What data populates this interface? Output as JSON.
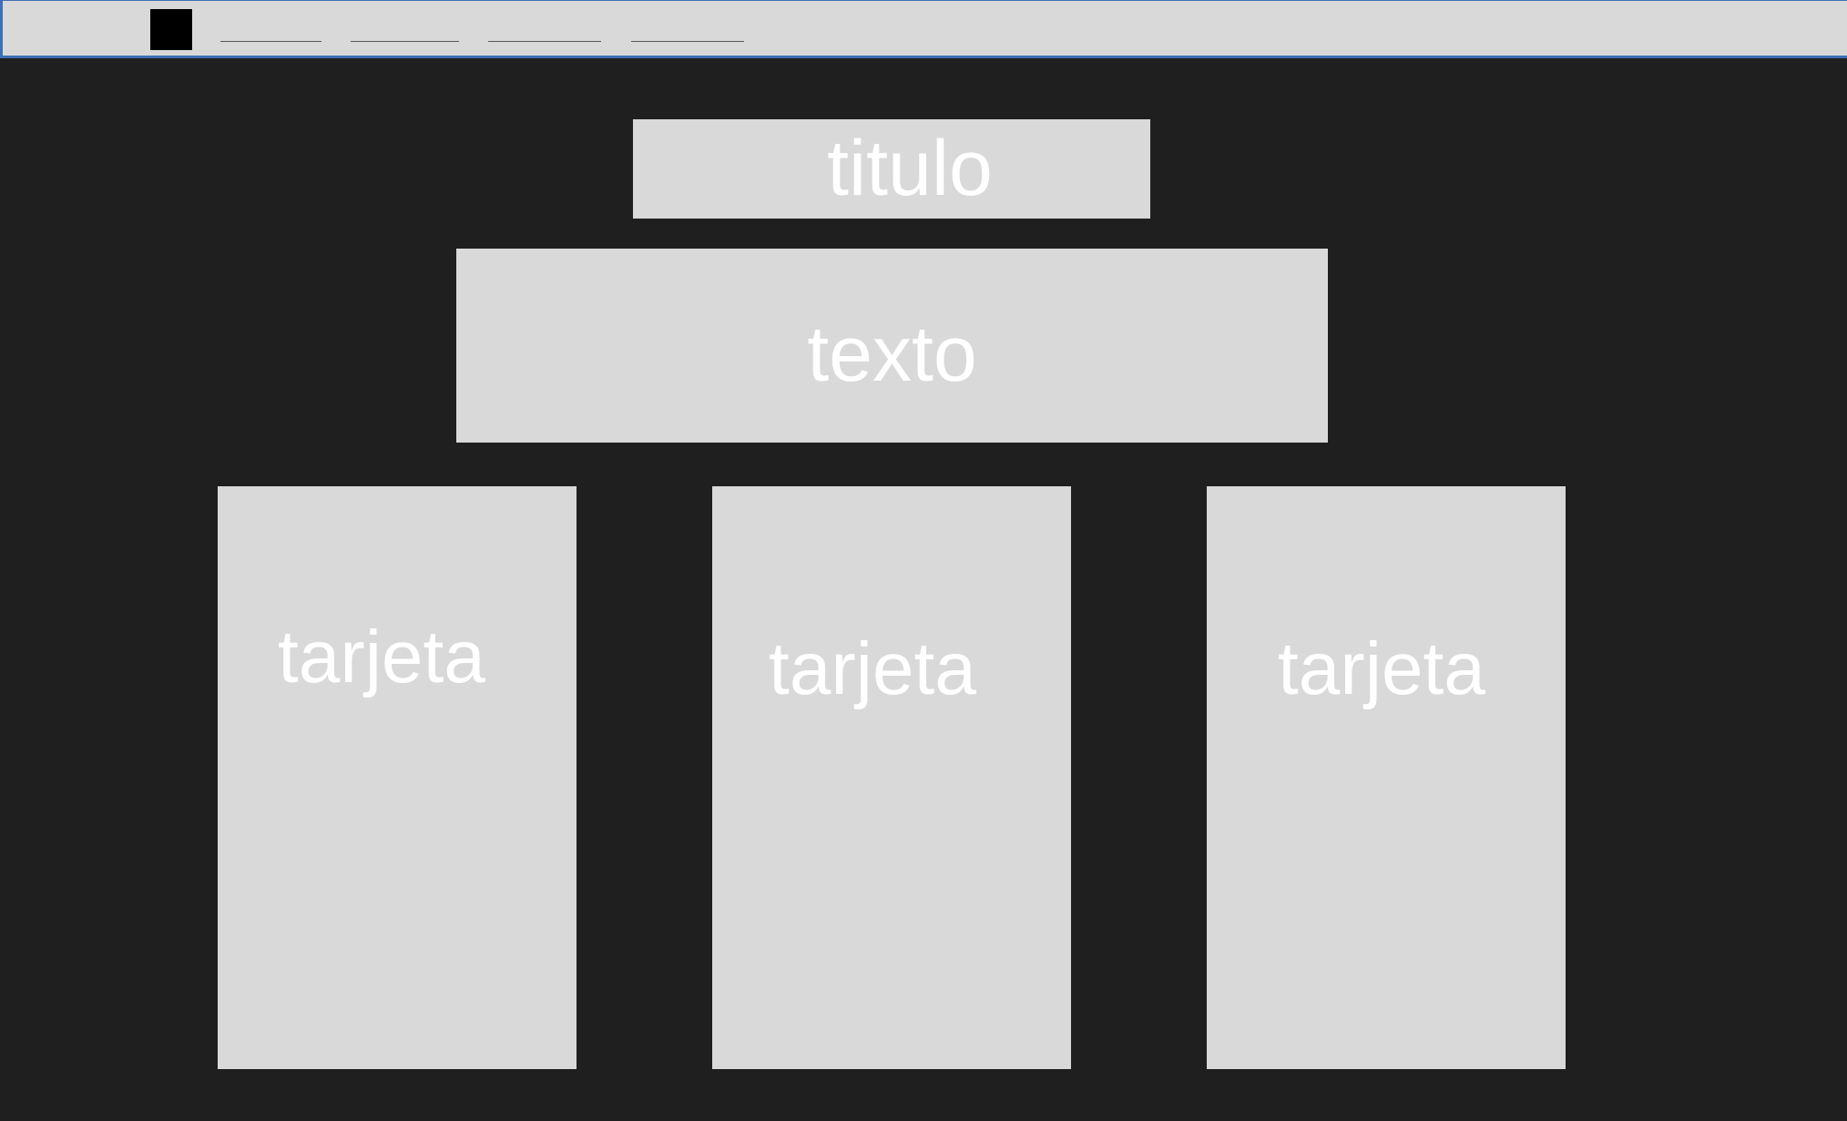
{
  "header": {
    "logo_color": "#000000",
    "nav_links": [
      "",
      "",
      "",
      ""
    ]
  },
  "main": {
    "title": "titulo",
    "text": "texto",
    "cards": [
      {
        "label": "tarjeta"
      },
      {
        "label": "tarjeta"
      },
      {
        "label": "tarjeta"
      }
    ]
  },
  "colors": {
    "background": "#1f1f1f",
    "box": "#d9d9d9",
    "text": "#ffffff",
    "header_border": "#3f6fb5"
  }
}
